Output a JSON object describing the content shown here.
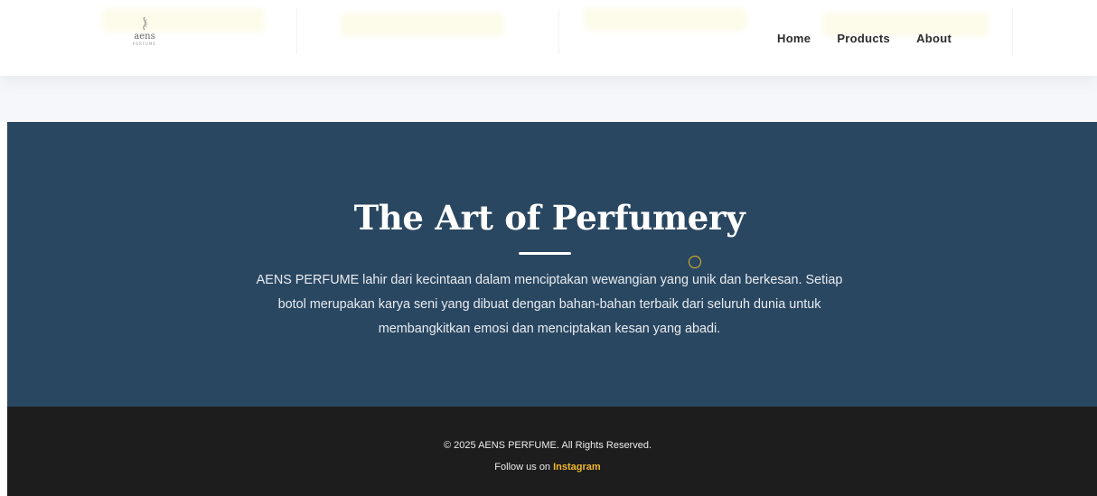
{
  "brand": {
    "name": "aens",
    "tagline": "PERFUME"
  },
  "nav": {
    "items": [
      "Home",
      "Products",
      "About"
    ]
  },
  "hero": {
    "title": "The Art of Perfumery",
    "body": "AENS PERFUME lahir dari kecintaan dalam menciptakan wewangian yang unik dan berkesan. Setiap botol merupakan karya seni yang dibuat dengan bahan-bahan terbaik dari seluruh dunia untuk membangkitkan emosi dan menciptakan kesan yang abadi."
  },
  "footer": {
    "copyright": "© 2025 AENS PERFUME. All Rights Reserved.",
    "follow_prefix": "Follow us on",
    "follow_link": "Instagram"
  },
  "colors": {
    "hero_bg": "#2a4761",
    "footer_bg": "#1d1d1d",
    "accent": "#f0b72f"
  },
  "icons": {
    "logo": "flame-swirl-icon",
    "cursor": "cursor-ring-icon"
  }
}
